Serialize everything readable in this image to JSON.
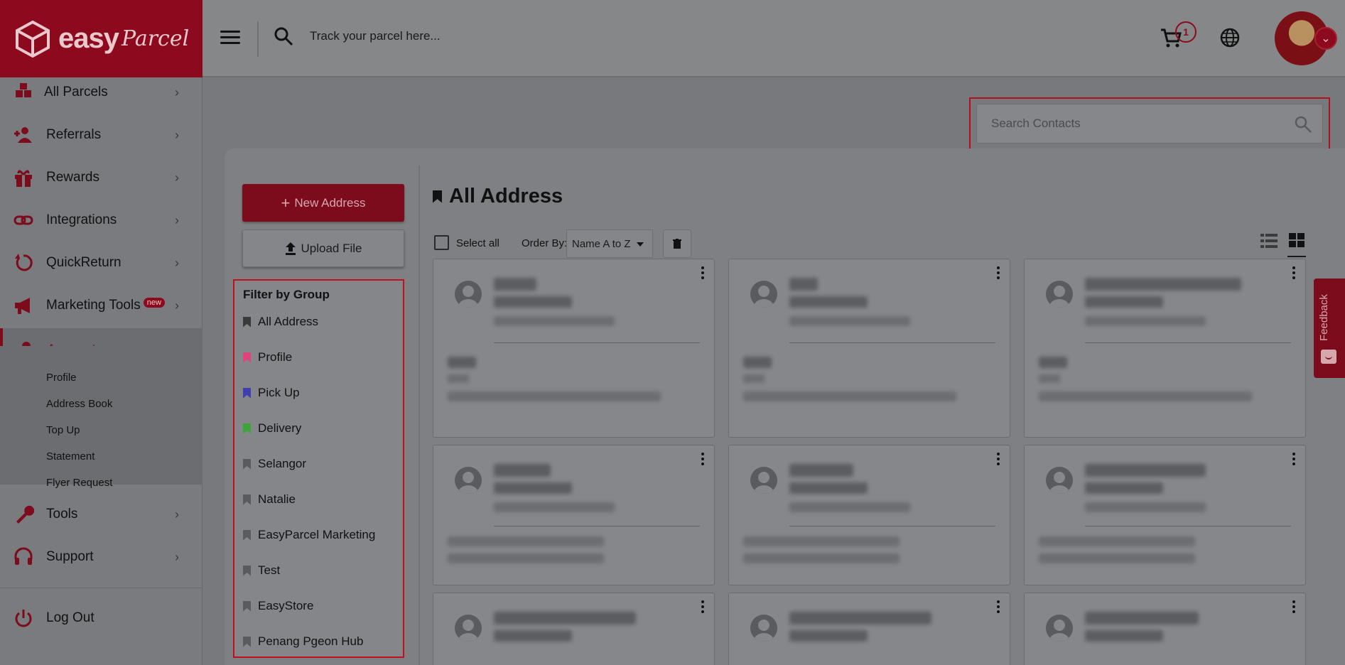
{
  "header": {
    "logo_text": "easy",
    "logo_script": "Parcel",
    "track_placeholder": "Track your parcel here...",
    "cart_count": "1"
  },
  "sidebar": {
    "items": [
      {
        "label": "All Parcels",
        "icon": "parcels-icon"
      },
      {
        "label": "Referrals",
        "icon": "referrals-icon"
      },
      {
        "label": "Rewards",
        "icon": "gift-icon"
      },
      {
        "label": "Integrations",
        "icon": "link-icon"
      },
      {
        "label": "QuickReturn",
        "icon": "return-icon"
      },
      {
        "label": "Marketing Tools",
        "icon": "megaphone-icon",
        "badge": "new"
      },
      {
        "label": "Account",
        "icon": "user-icon"
      },
      {
        "label": "Tools",
        "icon": "wrench-icon"
      },
      {
        "label": "Support",
        "icon": "headset-icon"
      },
      {
        "label": "Log Out",
        "icon": "power-icon"
      }
    ],
    "account_sub": [
      "Profile",
      "Address Book",
      "Top Up",
      "Statement",
      "Flyer Request"
    ]
  },
  "search_contacts": {
    "placeholder": "Search Contacts"
  },
  "actions": {
    "new_address": "New Address",
    "upload_file": "Upload File"
  },
  "filter": {
    "title": "Filter by Group",
    "groups": [
      {
        "label": "All Address",
        "color": "#3a3a3a"
      },
      {
        "label": "Profile",
        "color": "#e0427e"
      },
      {
        "label": "Pick Up",
        "color": "#3f3fb0"
      },
      {
        "label": "Delivery",
        "color": "#3aa63a"
      },
      {
        "label": "Selangor",
        "color": "#5a5b5e"
      },
      {
        "label": "Natalie",
        "color": "#5a5b5e"
      },
      {
        "label": "EasyParcel Marketing",
        "color": "#5a5b5e"
      },
      {
        "label": "Test",
        "color": "#5a5b5e"
      },
      {
        "label": "EasyStore",
        "color": "#5a5b5e"
      },
      {
        "label": "Penang Pgeon Hub",
        "color": "#5a5b5e"
      }
    ]
  },
  "content": {
    "title": "All Address",
    "select_all": "Select all",
    "order_by_label": "Order By:",
    "order_by_value": "Name A to Z"
  },
  "feedback": {
    "label": "Feedback"
  },
  "colors": {
    "brand": "#c8102e"
  }
}
